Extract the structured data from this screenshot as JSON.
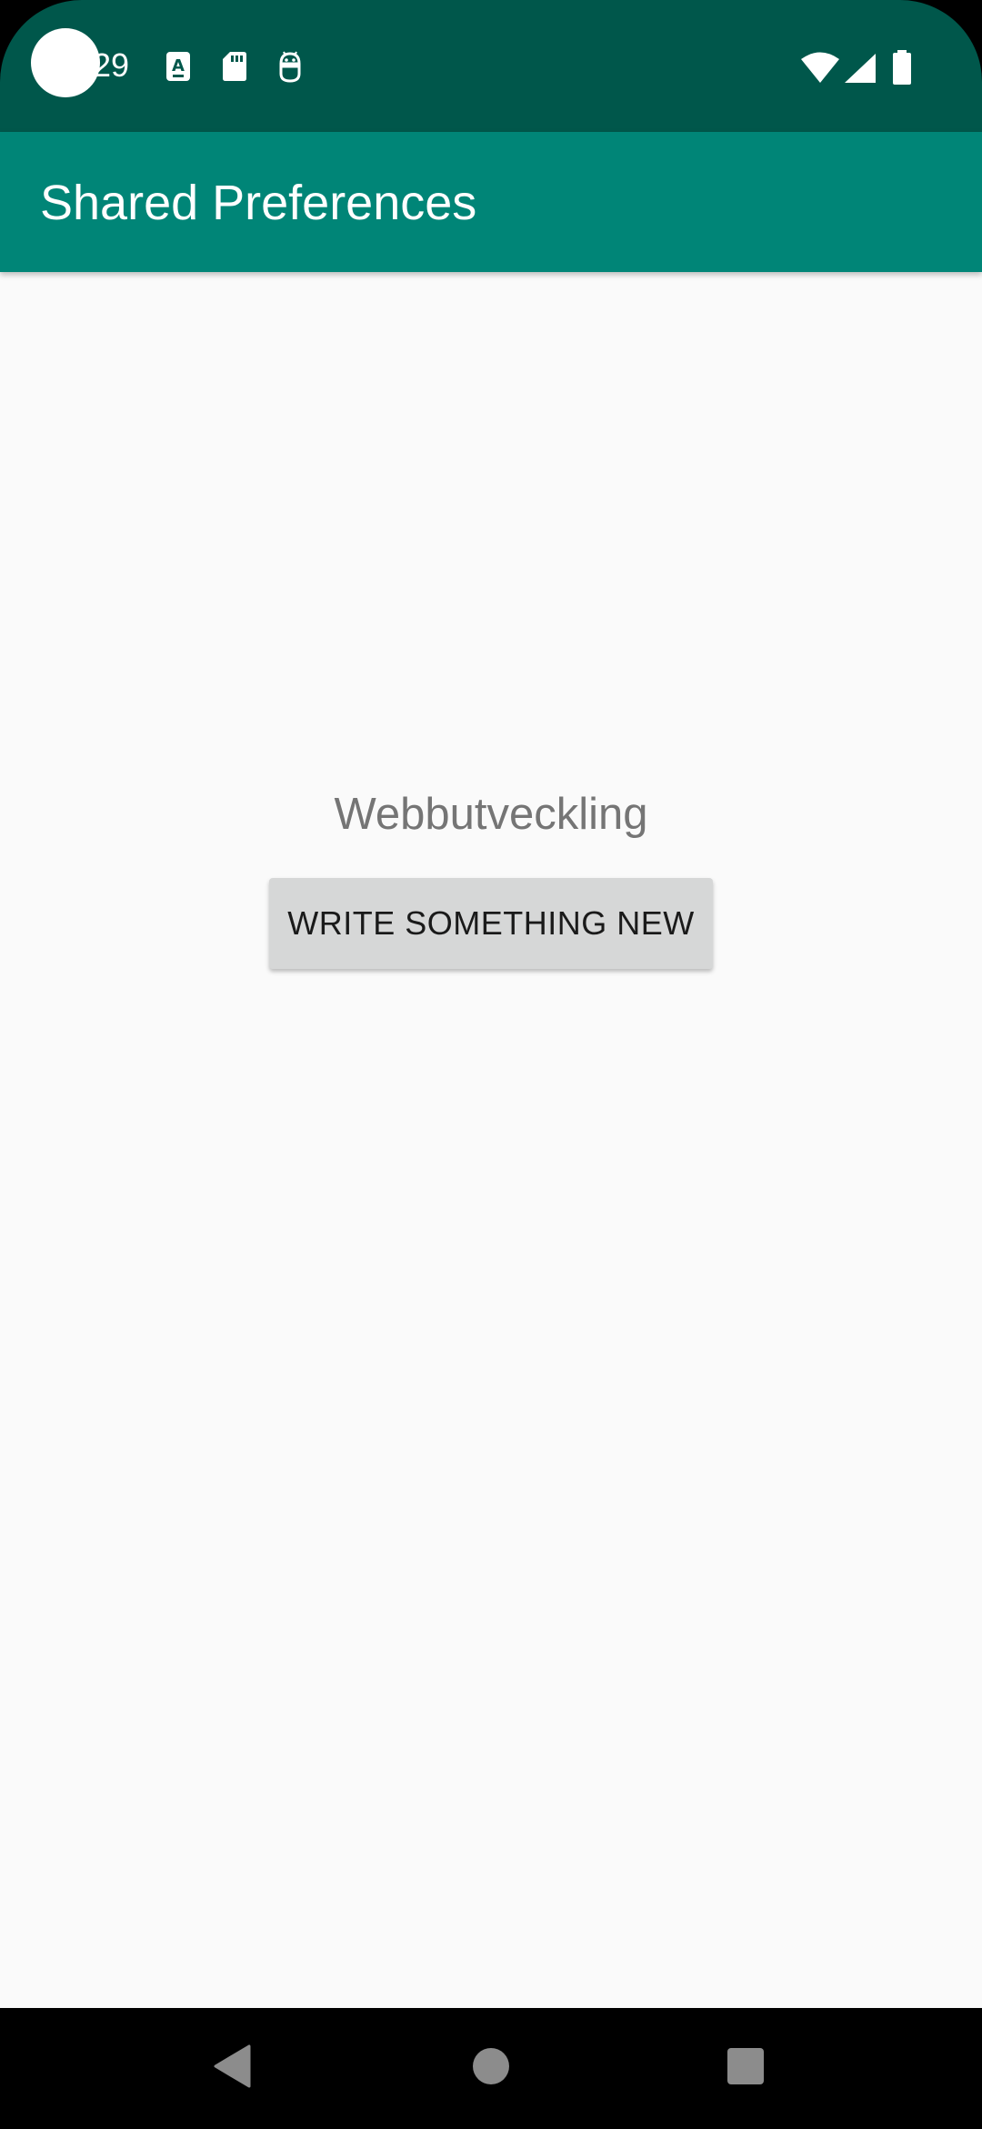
{
  "status_bar": {
    "time": "29",
    "left_icons": [
      "font-a-icon",
      "sd-card-icon",
      "android-debug-icon"
    ],
    "right_icons": [
      "wifi-icon",
      "cell-signal-icon",
      "battery-icon"
    ]
  },
  "app_bar": {
    "title": "Shared Preferences"
  },
  "content": {
    "text": "Webbutveckling",
    "button_label": "WRITE SOMETHING NEW"
  },
  "nav_bar": {
    "buttons": [
      "back-icon",
      "home-icon",
      "recents-icon"
    ]
  },
  "colors": {
    "status_bar": "#00574B",
    "app_bar": "#008577",
    "background": "#FAFAFA",
    "button": "#D6D7D7",
    "text_secondary": "#757575"
  }
}
